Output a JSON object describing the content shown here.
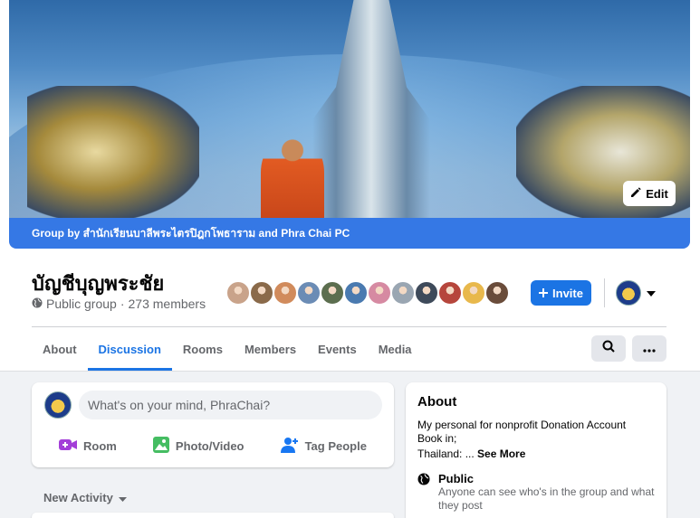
{
  "cover": {
    "edit_label": "Edit",
    "group_by_text": "Group by สำนักเรียนบาลีพระไตรปิฎกโพธาราม and Phra Chai PC"
  },
  "group": {
    "title": "บัญชีบุญพระชัย",
    "privacy": "Public group",
    "separator": "·",
    "members": "273 members"
  },
  "members_avatars": [
    {
      "color": "#c9a38a"
    },
    {
      "color": "#8a6a4a"
    },
    {
      "color": "#d18b5c"
    },
    {
      "color": "#6b8cb5"
    },
    {
      "color": "#5c6e4f"
    },
    {
      "color": "#4a7ab0"
    },
    {
      "color": "#d68aa2"
    },
    {
      "color": "#9aa6b2"
    },
    {
      "color": "#3e4a5a"
    },
    {
      "color": "#b6463c"
    },
    {
      "color": "#e8b84c"
    },
    {
      "color": "#6a4c3a"
    }
  ],
  "actions": {
    "invite_label": "Invite"
  },
  "tabs": [
    {
      "label": "About",
      "active": false
    },
    {
      "label": "Discussion",
      "active": true
    },
    {
      "label": "Rooms",
      "active": false
    },
    {
      "label": "Members",
      "active": false
    },
    {
      "label": "Events",
      "active": false
    },
    {
      "label": "Media",
      "active": false
    }
  ],
  "composer": {
    "placeholder": "What's on your mind, PhraChai?",
    "room_label": "Room",
    "photo_label": "Photo/Video",
    "tag_label": "Tag People"
  },
  "feed": {
    "sort_label": "New Activity"
  },
  "about": {
    "title": "About",
    "description": "My personal for nonprofit Donation Account Book in;",
    "description_2": "Thailand: ...",
    "see_more": "See More",
    "privacy_title": "Public",
    "privacy_sub": "Anyone can see who's in the group and what they post"
  },
  "colors": {
    "accent": "#1b74e4",
    "group_bar": "#3578e5",
    "page_bg": "#f0f2f5"
  }
}
